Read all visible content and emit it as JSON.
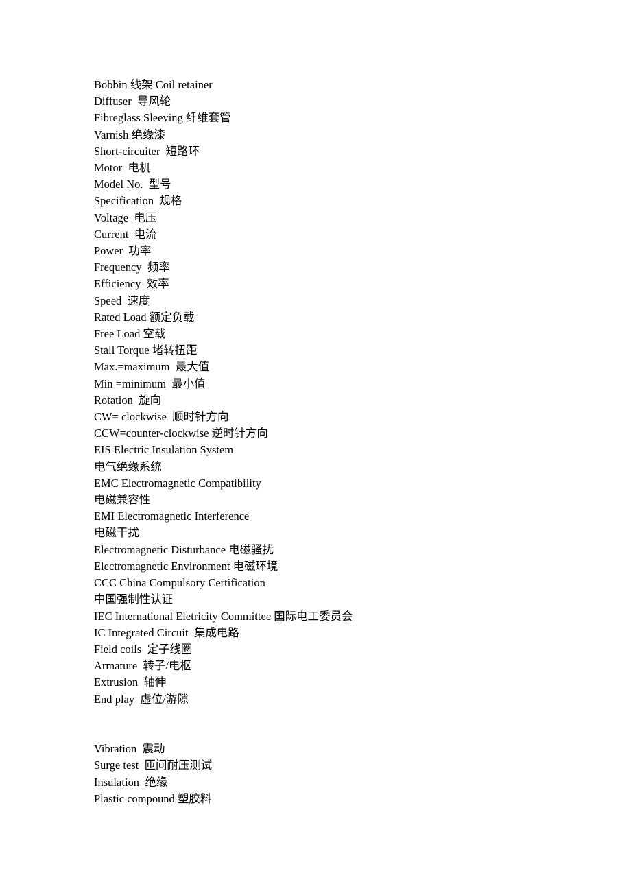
{
  "document": {
    "type": "glossary",
    "language": "English-Chinese",
    "background_color": "#ffffff",
    "text_color": "#000000",
    "blocks": [
      {
        "id": "block-1",
        "lines": [
          "Bobbin 线架 Coil retainer",
          "Diffuser  导风轮",
          "Fibreglass Sleeving 纤维套管",
          "Varnish 绝缘漆",
          "Short-circuiter  短路环",
          "Motor  电机",
          "Model No.  型号",
          "Specification  规格",
          "Voltage  电压",
          "Current  电流",
          "Power  功率",
          "Frequency  频率",
          "Efficiency  效率",
          "Speed  速度",
          "Rated Load 额定负载",
          "Free Load 空载",
          "Stall Torque 堵转扭距",
          "Max.=maximum  最大值",
          "Min =minimum  最小值",
          "Rotation  旋向",
          "CW= clockwise  顺时针方向",
          "CCW=counter-clockwise 逆时针方向",
          "EIS Electric Insulation System",
          "电气绝缘系统",
          "EMC Electromagnetic Compatibility",
          "电磁兼容性",
          "EMI Electromagnetic Interference",
          "电磁干扰",
          "Electromagnetic Disturbance 电磁骚扰",
          "Electromagnetic Environment 电磁环境",
          "CCC China Compulsory Certification",
          "中国强制性认证",
          "IEC International Eletricity Committee 国际电工委员会",
          "IC Integrated Circuit  集成电路",
          "Field coils  定子线圈",
          "Armature  转子/电枢",
          "Extrusion  轴伸",
          "End play  虚位/游隙"
        ]
      },
      {
        "id": "block-2",
        "lines": [
          "Vibration  震动",
          "Surge test  匝间耐压测试",
          "Insulation  绝缘",
          "Plastic compound 塑胶料"
        ]
      }
    ]
  }
}
